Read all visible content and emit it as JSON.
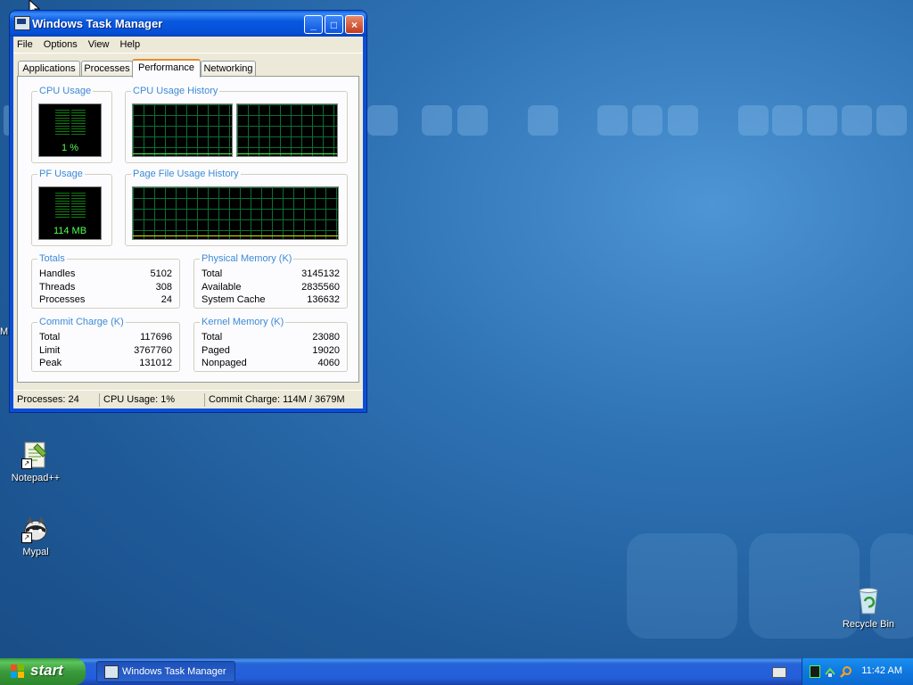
{
  "desktop": {
    "icons": [
      {
        "label": "Notepad++"
      },
      {
        "label": "Mypal"
      },
      {
        "label": "Recycle Bin"
      }
    ],
    "edge_text": "M"
  },
  "window": {
    "title": "Windows Task Manager",
    "controls": {
      "minimize": "_",
      "maximize": "□",
      "close": "×"
    },
    "menu": [
      "File",
      "Options",
      "View",
      "Help"
    ],
    "tabs": [
      "Applications",
      "Processes",
      "Performance",
      "Networking"
    ],
    "active_tab": "Performance",
    "performance": {
      "cpu_usage": {
        "label": "CPU Usage",
        "value": "1 %"
      },
      "cpu_history": {
        "label": "CPU Usage History"
      },
      "pf_usage": {
        "label": "PF Usage",
        "value": "114 MB"
      },
      "pf_history": {
        "label": "Page File Usage History"
      },
      "totals": {
        "label": "Totals",
        "rows": [
          {
            "name": "Handles",
            "value": "5102"
          },
          {
            "name": "Threads",
            "value": "308"
          },
          {
            "name": "Processes",
            "value": "24"
          }
        ]
      },
      "physical_memory": {
        "label": "Physical Memory (K)",
        "rows": [
          {
            "name": "Total",
            "value": "3145132"
          },
          {
            "name": "Available",
            "value": "2835560"
          },
          {
            "name": "System Cache",
            "value": "136632"
          }
        ]
      },
      "commit_charge": {
        "label": "Commit Charge (K)",
        "rows": [
          {
            "name": "Total",
            "value": "117696"
          },
          {
            "name": "Limit",
            "value": "3767760"
          },
          {
            "name": "Peak",
            "value": "131012"
          }
        ]
      },
      "kernel_memory": {
        "label": "Kernel Memory (K)",
        "rows": [
          {
            "name": "Total",
            "value": "23080"
          },
          {
            "name": "Paged",
            "value": "19020"
          },
          {
            "name": "Nonpaged",
            "value": "4060"
          }
        ]
      }
    },
    "statusbar": {
      "processes": "Processes: 24",
      "cpu": "CPU Usage: 1%",
      "commit": "Commit Charge: 114M / 3679M"
    }
  },
  "taskbar": {
    "start_label": "start",
    "task_button": "Windows Task Manager",
    "clock": "11:42 AM"
  },
  "colors": {
    "titlebar": "#0a5ce8",
    "group_label": "#3d8ad6",
    "meter_green": "#4eff4e",
    "active_tab_accent": "#e68b2c",
    "taskbar": "#245edb",
    "start_button": "#3a9a3a",
    "tray": "#0f78e0"
  }
}
